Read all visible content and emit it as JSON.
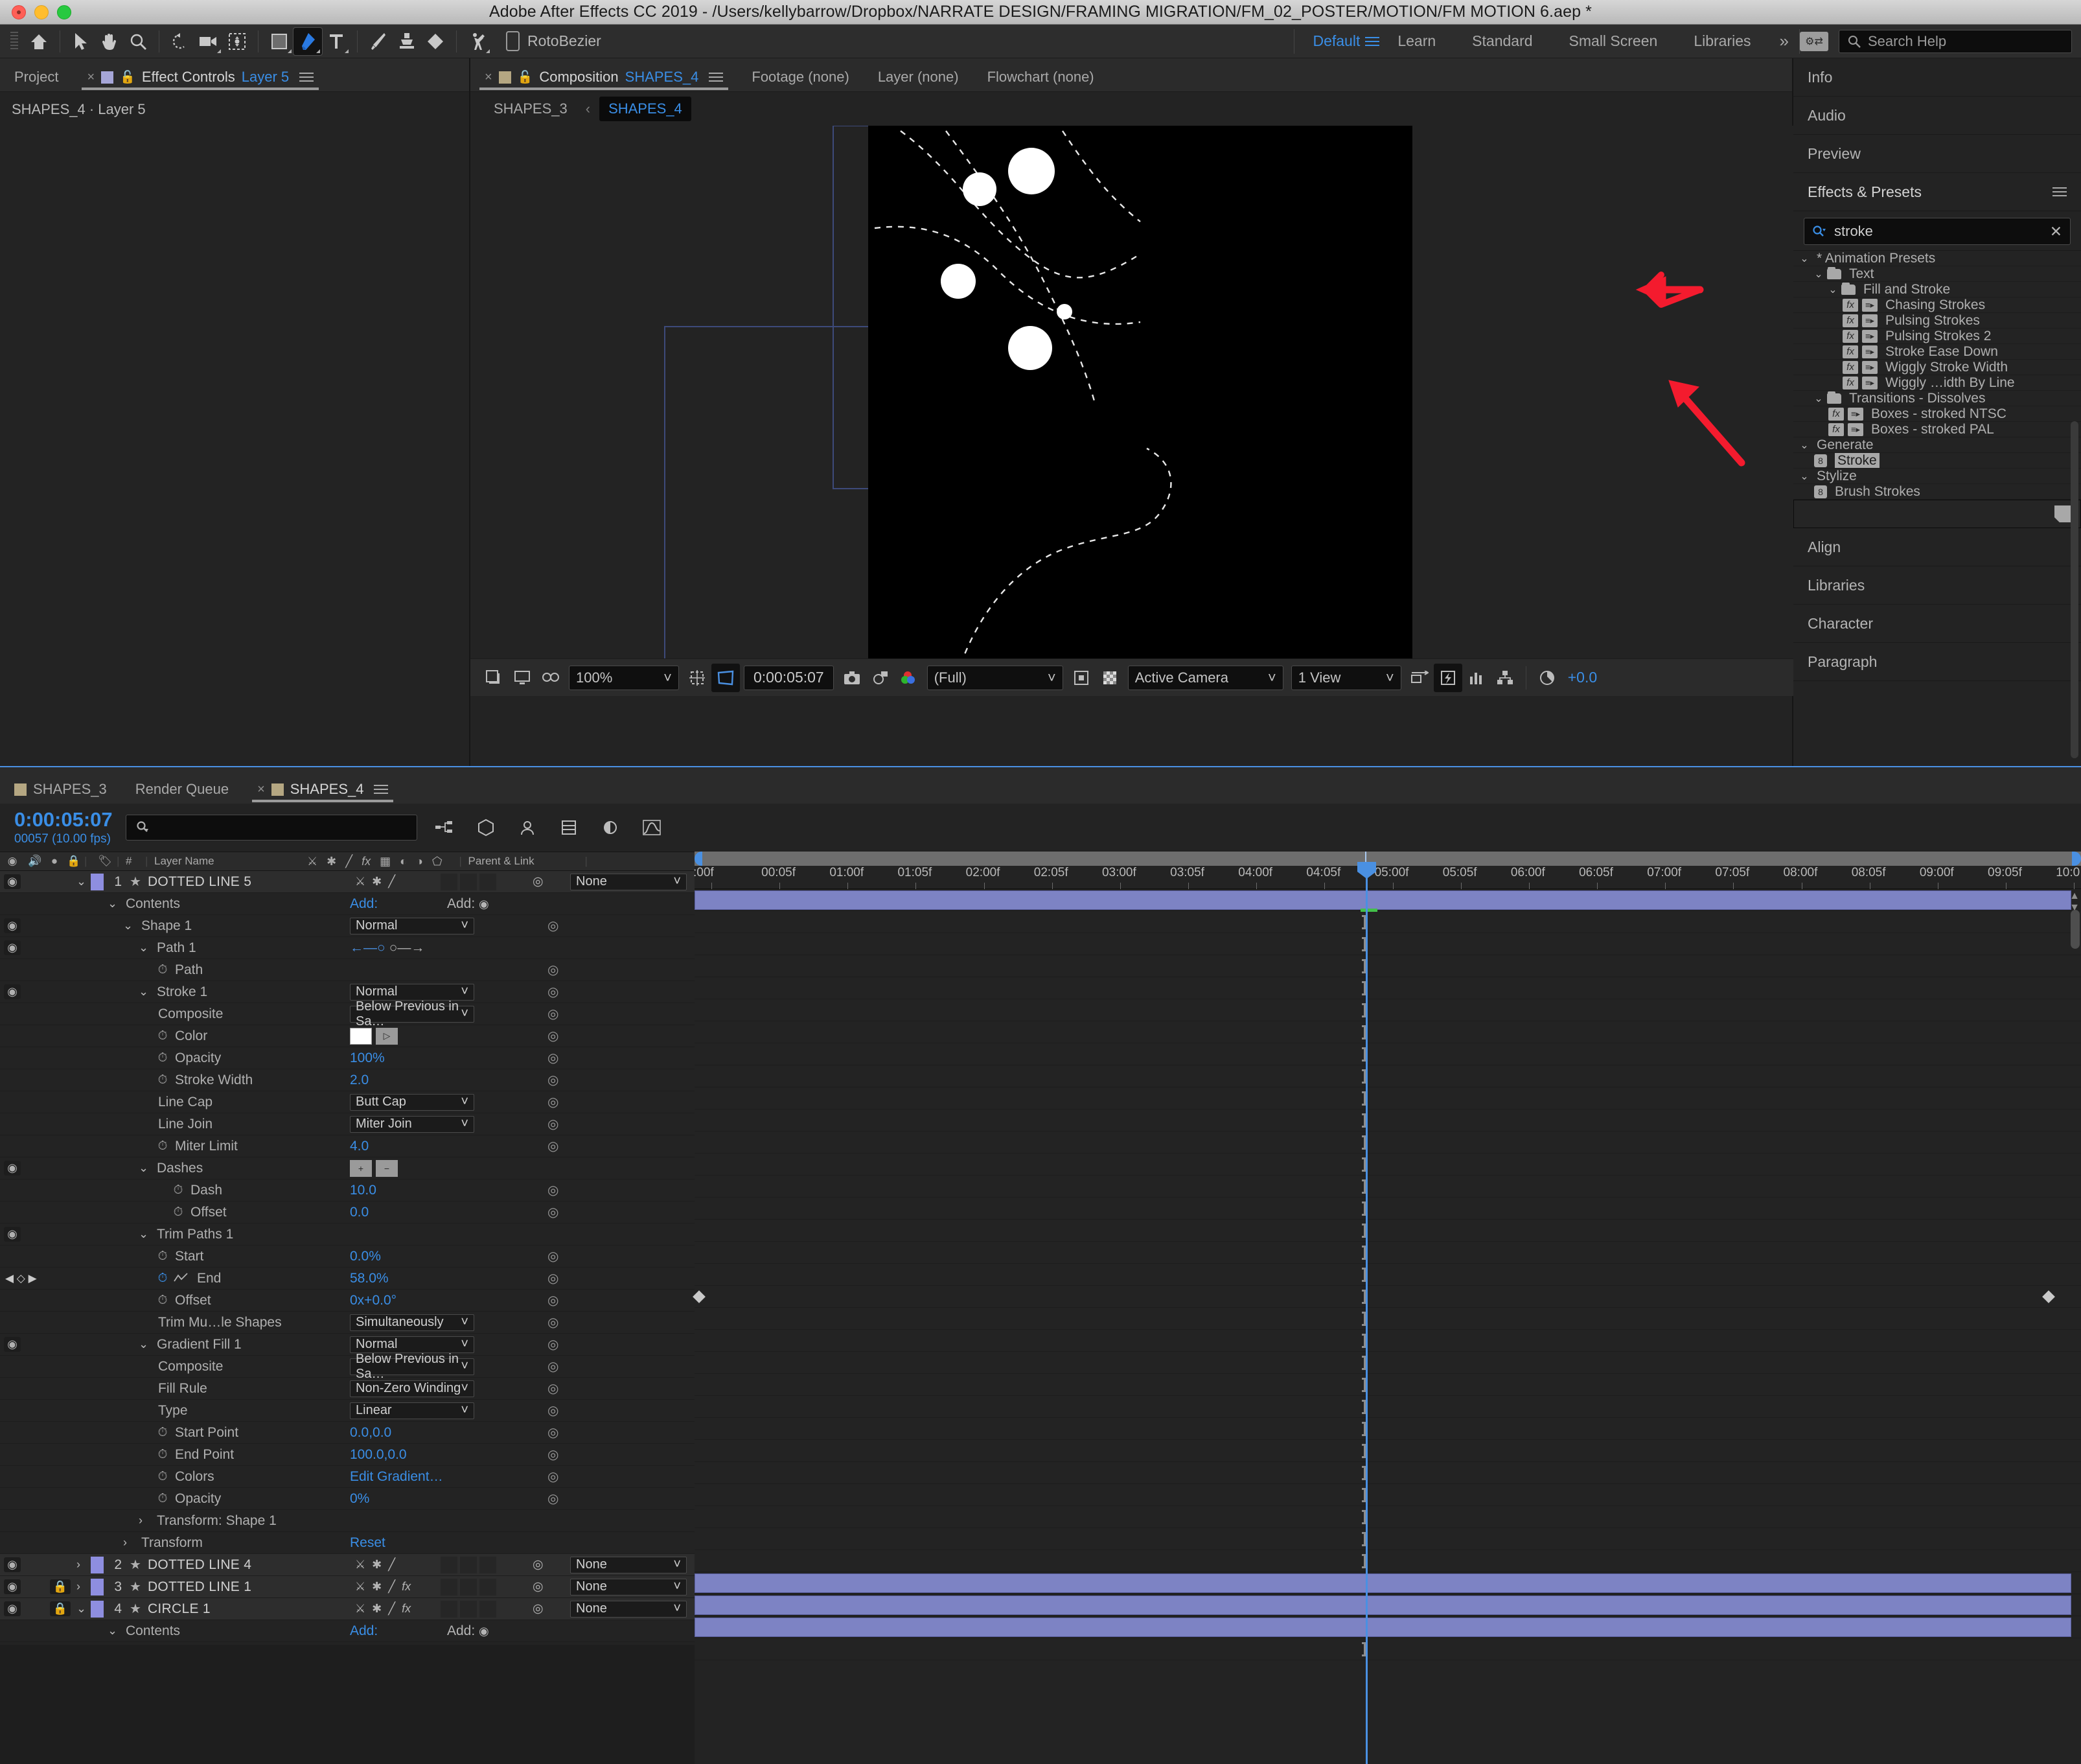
{
  "window": {
    "title": "Adobe After Effects CC 2019 - /Users/kellybarrow/Dropbox/NARRATE DESIGN/FRAMING MIGRATION/FM_02_POSTER/MOTION/FM  MOTION 6.aep *"
  },
  "toolbar": {
    "tools": [
      {
        "name": "home-icon",
        "glyph": "home"
      },
      {
        "name": "selection-tool",
        "glyph": "arrow"
      },
      {
        "name": "hand-tool",
        "glyph": "hand"
      },
      {
        "name": "zoom-tool",
        "glyph": "magnifier"
      },
      {
        "name": "rotation-tool",
        "glyph": "rotate"
      },
      {
        "name": "camera-tool",
        "glyph": "camera"
      },
      {
        "name": "pan-behind-tool",
        "glyph": "anchor"
      },
      {
        "name": "shape-tool",
        "glyph": "rect"
      },
      {
        "name": "pen-tool",
        "glyph": "pen"
      },
      {
        "name": "type-tool",
        "glyph": "type"
      },
      {
        "name": "brush-tool",
        "glyph": "brush"
      },
      {
        "name": "clone-stamp-tool",
        "glyph": "stamp"
      },
      {
        "name": "eraser-tool",
        "glyph": "eraser"
      },
      {
        "name": "roto-brush-tool",
        "glyph": "roto"
      },
      {
        "name": "puppet-tool",
        "glyph": "puppet"
      }
    ],
    "roto_label": "RotoBezier",
    "workspaces": [
      "Default",
      "Learn",
      "Standard",
      "Small Screen",
      "Libraries"
    ],
    "selected_workspace": "Default",
    "overflow": "»",
    "search_help_placeholder": "Search Help"
  },
  "left_panel": {
    "tabs": [
      {
        "label": "Project",
        "active": false,
        "closable": false
      },
      {
        "label": "Effect Controls",
        "sub": "Layer 5",
        "active": true,
        "closable": true
      }
    ],
    "subtitle": "SHAPES_4 · Layer 5"
  },
  "comp_panel": {
    "tabs": [
      {
        "label": "Composition",
        "sub": "SHAPES_4",
        "active": true,
        "closable": true
      },
      {
        "label": "Footage (none)",
        "active": false
      },
      {
        "label": "Layer (none)",
        "active": false
      },
      {
        "label": "Flowchart (none)",
        "active": false
      }
    ],
    "breadcrumb": [
      "SHAPES_3",
      "SHAPES_4"
    ],
    "breadcrumb_sep": "‹",
    "breadcrumb_active": "SHAPES_4",
    "viewer_toolbar": {
      "zoom": "100%",
      "timecode": "0:00:05:07",
      "resolution": "(Full)",
      "view": "Active Camera",
      "view_layout": "1 View",
      "exposure": "+0.0"
    }
  },
  "right_panels": {
    "stack_top": [
      "Info",
      "Audio",
      "Preview"
    ],
    "effects_presets": {
      "title": "Effects & Presets",
      "search_value": "stroke",
      "search_placeholder": "",
      "clear_glyph": "✕",
      "items": [
        {
          "label": "* Animation Presets",
          "indent": 0,
          "type": "group",
          "expanded": true
        },
        {
          "label": "Text",
          "indent": 1,
          "type": "folder",
          "expanded": true
        },
        {
          "label": "Fill and Stroke",
          "indent": 2,
          "type": "folder",
          "expanded": true
        },
        {
          "label": "Chasing Strokes",
          "indent": 3,
          "type": "preset"
        },
        {
          "label": "Pulsing Strokes",
          "indent": 3,
          "type": "preset"
        },
        {
          "label": "Pulsing Strokes 2",
          "indent": 3,
          "type": "preset"
        },
        {
          "label": "Stroke Ease Down",
          "indent": 3,
          "type": "preset"
        },
        {
          "label": "Wiggly Stroke Width",
          "indent": 3,
          "type": "preset"
        },
        {
          "label": "Wiggly …idth By Line",
          "indent": 3,
          "type": "preset"
        },
        {
          "label": "Transitions - Dissolves",
          "indent": 1,
          "type": "folder",
          "expanded": true
        },
        {
          "label": "Boxes - stroked NTSC",
          "indent": 2,
          "type": "preset"
        },
        {
          "label": "Boxes - stroked PAL",
          "indent": 2,
          "type": "preset"
        },
        {
          "label": "Generate",
          "indent": 0,
          "type": "group",
          "expanded": true
        },
        {
          "label": "Stroke",
          "indent": 1,
          "type": "effect",
          "selected": true
        },
        {
          "label": "Stylize",
          "indent": 0,
          "type": "group",
          "expanded": true
        },
        {
          "label": "Brush Strokes",
          "indent": 1,
          "type": "effect"
        }
      ]
    },
    "stack_bottom": [
      "Align",
      "Libraries",
      "Character",
      "Paragraph"
    ]
  },
  "timeline": {
    "tabs": [
      {
        "label": "SHAPES_3",
        "active": false,
        "closable": false
      },
      {
        "label": "Render Queue",
        "active": false,
        "closable": false
      },
      {
        "label": "SHAPES_4",
        "active": true,
        "closable": true
      }
    ],
    "current_time": "0:00:05:07",
    "frame_info": "00057 (10.00 fps)",
    "search_placeholder": "",
    "columns": [
      "#",
      "Layer Name",
      "Parent & Link"
    ],
    "ruler_ticks": [
      ":00f",
      "00:05f",
      "01:00f",
      "01:05f",
      "02:00f",
      "02:05f",
      "03:00f",
      "03:05f",
      "04:00f",
      "04:05f",
      "05:00f",
      "05:05f",
      "06:00f",
      "06:05f",
      "07:00f",
      "07:05f",
      "08:00f",
      "08:05f",
      "09:00f",
      "09:05f",
      "10:0"
    ],
    "rows": [
      {
        "kind": "layer",
        "indent": 0,
        "num": "1",
        "name": "DOTTED LINE 5",
        "parent": "None",
        "eye": true,
        "lock": false,
        "expanded": true,
        "fx": false,
        "selected": true
      },
      {
        "kind": "group",
        "indent": 2,
        "name": "Contents",
        "value": "Add:",
        "eye": false,
        "expanded": true
      },
      {
        "kind": "group",
        "indent": 3,
        "name": "Shape 1",
        "select": "Normal",
        "eye": true,
        "expanded": true
      },
      {
        "kind": "group",
        "indent": 4,
        "name": "Path 1",
        "eye": true,
        "expanded": true,
        "pathicons": true
      },
      {
        "kind": "prop",
        "indent": 5,
        "name": "Path",
        "stopwatch": true
      },
      {
        "kind": "group",
        "indent": 4,
        "name": "Stroke 1",
        "select": "Normal",
        "eye": true,
        "expanded": true
      },
      {
        "kind": "prop",
        "indent": 5,
        "name": "Composite",
        "select": "Below Previous in Sa…"
      },
      {
        "kind": "prop",
        "indent": 5,
        "name": "Color",
        "stopwatch": true,
        "colorswatch": true
      },
      {
        "kind": "prop",
        "indent": 5,
        "name": "Opacity",
        "stopwatch": true,
        "value": "100%"
      },
      {
        "kind": "prop",
        "indent": 5,
        "name": "Stroke Width",
        "stopwatch": true,
        "value": "2.0"
      },
      {
        "kind": "prop",
        "indent": 5,
        "name": "Line Cap",
        "select": "Butt Cap"
      },
      {
        "kind": "prop",
        "indent": 5,
        "name": "Line Join",
        "select": "Miter Join"
      },
      {
        "kind": "prop",
        "indent": 5,
        "name": "Miter Limit",
        "stopwatch": true,
        "value": "4.0"
      },
      {
        "kind": "group",
        "indent": 4,
        "name": "Dashes",
        "eye": true,
        "expanded": true,
        "plusminus": true
      },
      {
        "kind": "prop",
        "indent": 6,
        "name": "Dash",
        "stopwatch": true,
        "value": "10.0"
      },
      {
        "kind": "prop",
        "indent": 6,
        "name": "Offset",
        "stopwatch": true,
        "value": "0.0"
      },
      {
        "kind": "group",
        "indent": 4,
        "name": "Trim Paths 1",
        "eye": true,
        "expanded": true
      },
      {
        "kind": "prop",
        "indent": 5,
        "name": "Start",
        "stopwatch": true,
        "value": "0.0%"
      },
      {
        "kind": "prop",
        "indent": 5,
        "name": "End",
        "stopwatch": true,
        "value": "58.0%",
        "animated": true,
        "keyframed": true
      },
      {
        "kind": "prop",
        "indent": 5,
        "name": "Offset",
        "stopwatch": true,
        "value": "0x+0.0°"
      },
      {
        "kind": "prop",
        "indent": 5,
        "name": "Trim Mu…le Shapes",
        "select": "Simultaneously"
      },
      {
        "kind": "group",
        "indent": 4,
        "name": "Gradient Fill 1",
        "select": "Normal",
        "eye": true,
        "expanded": true
      },
      {
        "kind": "prop",
        "indent": 5,
        "name": "Composite",
        "select": "Below Previous in Sa…"
      },
      {
        "kind": "prop",
        "indent": 5,
        "name": "Fill Rule",
        "select": "Non-Zero Winding"
      },
      {
        "kind": "prop",
        "indent": 5,
        "name": "Type",
        "select": "Linear"
      },
      {
        "kind": "prop",
        "indent": 5,
        "name": "Start Point",
        "stopwatch": true,
        "value": "0.0,0.0"
      },
      {
        "kind": "prop",
        "indent": 5,
        "name": "End Point",
        "stopwatch": true,
        "value": "100.0,0.0"
      },
      {
        "kind": "prop",
        "indent": 5,
        "name": "Colors",
        "stopwatch": true,
        "value": "Edit Gradient…"
      },
      {
        "kind": "prop",
        "indent": 5,
        "name": "Opacity",
        "stopwatch": true,
        "value": "0%"
      },
      {
        "kind": "group",
        "indent": 4,
        "name": "Transform: Shape 1",
        "expanded": false
      },
      {
        "kind": "group",
        "indent": 3,
        "name": "Transform",
        "value": "Reset",
        "expanded": false
      },
      {
        "kind": "layer",
        "indent": 0,
        "num": "2",
        "name": "DOTTED LINE 4",
        "parent": "None",
        "eye": true,
        "lock": false,
        "expanded": false,
        "fx": false
      },
      {
        "kind": "layer",
        "indent": 0,
        "num": "3",
        "name": "DOTTED LINE 1",
        "parent": "None",
        "eye": true,
        "lock": true,
        "expanded": false,
        "fx": true
      },
      {
        "kind": "layer",
        "indent": 0,
        "num": "4",
        "name": "CIRCLE 1",
        "parent": "None",
        "eye": true,
        "lock": true,
        "expanded": true,
        "fx": true
      },
      {
        "kind": "group",
        "indent": 2,
        "name": "Contents",
        "value": "Add:",
        "expanded": true
      }
    ]
  },
  "annotations": {
    "arrow_color": "#f41b2e",
    "arrows": [
      {
        "name": "arrow-pointing-left-to-dashed-line"
      },
      {
        "name": "arrow-pointing-up-to-small-circle"
      }
    ]
  },
  "colors": {
    "accent_blue": "#3a8ee6",
    "layer_bar": "#7d83c4",
    "panel_bg": "#232323",
    "canvas_bg": "#000000",
    "red_arrow": "#f41b2e"
  }
}
